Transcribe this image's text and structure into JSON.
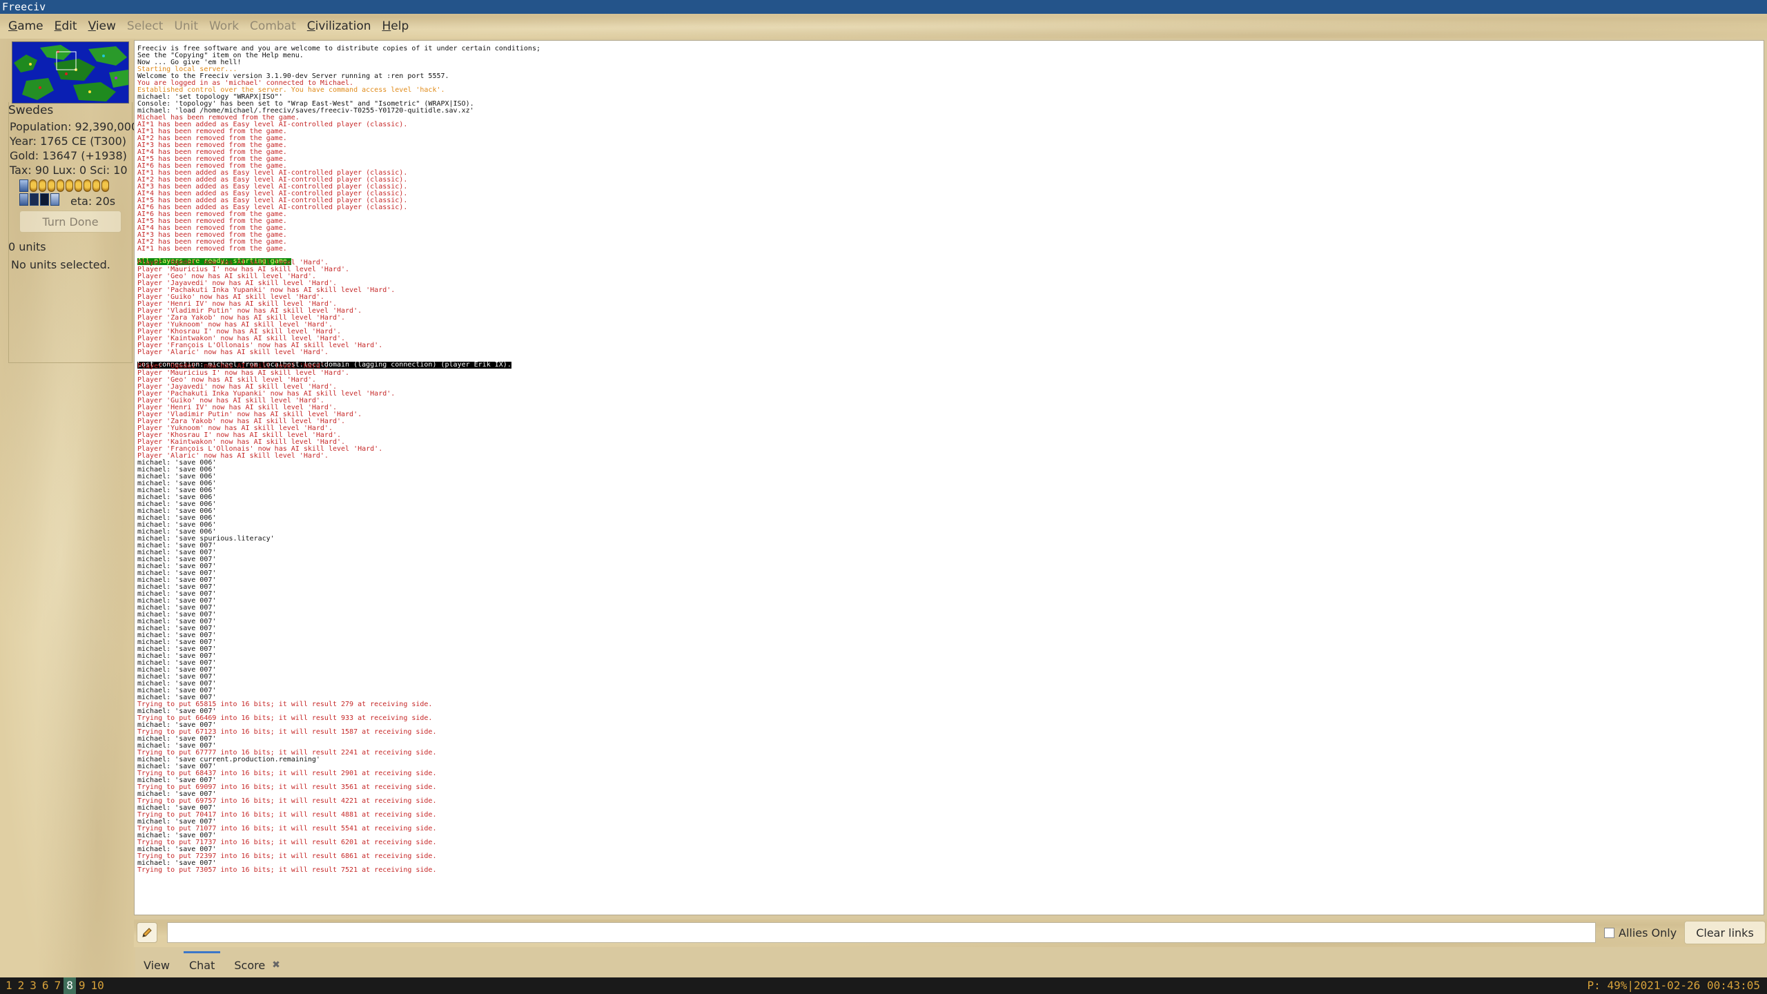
{
  "window": {
    "title": "Freeciv"
  },
  "menu": [
    {
      "label": "Game",
      "u": "G",
      "rest": "ame",
      "enabled": true
    },
    {
      "label": "Edit",
      "u": "E",
      "rest": "dit",
      "enabled": true
    },
    {
      "label": "View",
      "u": "V",
      "rest": "iew",
      "enabled": true
    },
    {
      "label": "Select",
      "u": "",
      "rest": "Select",
      "enabled": false
    },
    {
      "label": "Unit",
      "u": "",
      "rest": "Unit",
      "enabled": false
    },
    {
      "label": "Work",
      "u": "",
      "rest": "Work",
      "enabled": false
    },
    {
      "label": "Combat",
      "u": "",
      "rest": "Combat",
      "enabled": false
    },
    {
      "label": "Civilization",
      "u": "C",
      "rest": "ivilization",
      "enabled": true
    },
    {
      "label": "Help",
      "u": "H",
      "rest": "elp",
      "enabled": true
    }
  ],
  "info": {
    "nation": "Swedes",
    "population": "Population: 92,390,000",
    "year": "Year: 1765 CE (T300)",
    "gold": "Gold: 13647 (+1938)",
    "tax": "Tax: 90 Lux: 0 Sci: 10",
    "eta": "eta: 20s",
    "turn_done": "Turn Done",
    "units_count": "0 units",
    "units_selected": "No units selected."
  },
  "chat": {
    "lines": [
      {
        "c": "blk",
        "t": "Freeciv is free software and you are welcome to distribute copies of it under certain conditions;"
      },
      {
        "c": "blk",
        "t": "See the \"Copying\" item on the Help menu."
      },
      {
        "c": "blk",
        "t": "Now ... Go give 'em hell!"
      },
      {
        "c": "ora",
        "t": "Starting local server..."
      },
      {
        "c": "blk",
        "t": "Welcome to the Freeciv version 3.1.90-dev Server running at :ren port 5557."
      },
      {
        "c": "red",
        "t": "You are logged in as 'michael' connected to Michael."
      },
      {
        "c": "ora",
        "t": "Established control over the server. You have command access level 'hack'."
      },
      {
        "c": "blk",
        "t": "michael: 'set topology \"WRAPX|ISO\"'"
      },
      {
        "c": "blk",
        "t": "Console: 'topology' has been set to \"Wrap East-West\" and \"Isometric\" (WRAPX|ISO)."
      },
      {
        "c": "blk",
        "t": "michael: 'load /home/michael/.freeciv/saves/freeciv-T0255-Y01720-quitidle.sav.xz'"
      },
      {
        "c": "red",
        "t": "Michael has been removed from the game."
      },
      {
        "c": "red",
        "t": "AI*1 has been added as Easy level AI-controlled player (classic)."
      },
      {
        "c": "red",
        "t": "AI*1 has been removed from the game."
      },
      {
        "c": "red",
        "t": "AI*2 has been removed from the game."
      },
      {
        "c": "red",
        "t": "AI*3 has been removed from the game."
      },
      {
        "c": "red",
        "t": "AI*4 has been removed from the game."
      },
      {
        "c": "red",
        "t": "AI*5 has been removed from the game."
      },
      {
        "c": "red",
        "t": "AI*6 has been removed from the game."
      },
      {
        "c": "red",
        "t": "AI*1 has been added as Easy level AI-controlled player (classic)."
      },
      {
        "c": "red",
        "t": "AI*2 has been added as Easy level AI-controlled player (classic)."
      },
      {
        "c": "red",
        "t": "AI*3 has been added as Easy level AI-controlled player (classic)."
      },
      {
        "c": "red",
        "t": "AI*4 has been added as Easy level AI-controlled player (classic)."
      },
      {
        "c": "red",
        "t": "AI*5 has been added as Easy level AI-controlled player (classic)."
      },
      {
        "c": "red",
        "t": "AI*6 has been added as Easy level AI-controlled player (classic)."
      },
      {
        "c": "red",
        "t": "AI*6 has been removed from the game."
      },
      {
        "c": "red",
        "t": "AI*5 has been removed from the game."
      },
      {
        "c": "red",
        "t": "AI*4 has been removed from the game."
      },
      {
        "c": "red",
        "t": "AI*3 has been removed from the game."
      },
      {
        "c": "red",
        "t": "AI*2 has been removed from the game."
      },
      {
        "c": "red",
        "t": "AI*1 has been removed from the game."
      },
      {
        "c": "gh",
        "t": "All players are ready; starting game."
      },
      {
        "c": "red",
        "t": "Player 'Ogedei' now has AI skill level 'Hard'."
      },
      {
        "c": "red",
        "t": "Player 'Mauricius I' now has AI skill level 'Hard'."
      },
      {
        "c": "red",
        "t": "Player 'Geo' now has AI skill level 'Hard'."
      },
      {
        "c": "red",
        "t": "Player 'Jayavedi' now has AI skill level 'Hard'."
      },
      {
        "c": "red",
        "t": "Player 'Pachakuti Inka Yupanki' now has AI skill level 'Hard'."
      },
      {
        "c": "red",
        "t": "Player 'Guiko' now has AI skill level 'Hard'."
      },
      {
        "c": "red",
        "t": "Player 'Henri IV' now has AI skill level 'Hard'."
      },
      {
        "c": "red",
        "t": "Player 'Vladimir Putin' now has AI skill level 'Hard'."
      },
      {
        "c": "red",
        "t": "Player 'Zara Yakob' now has AI skill level 'Hard'."
      },
      {
        "c": "red",
        "t": "Player 'Yuknoom' now has AI skill level 'Hard'."
      },
      {
        "c": "red",
        "t": "Player 'Khosrau I' now has AI skill level 'Hard'."
      },
      {
        "c": "red",
        "t": "Player 'Kaintwakon' now has AI skill level 'Hard'."
      },
      {
        "c": "red",
        "t": "Player 'François L'Ollonais' now has AI skill level 'Hard'."
      },
      {
        "c": "red",
        "t": "Player 'Alaric' now has AI skill level 'Hard'."
      },
      {
        "c": "bh",
        "t": "Lost connection: michael from localhost.localdomain (lagging connection) (player Erik IX)."
      },
      {
        "c": "red",
        "t": "Player 'Ogedei' now has AI skill level 'Hard'."
      },
      {
        "c": "red",
        "t": "Player 'Mauricius I' now has AI skill level 'Hard'."
      },
      {
        "c": "red",
        "t": "Player 'Geo' now has AI skill level 'Hard'."
      },
      {
        "c": "red",
        "t": "Player 'Jayavedi' now has AI skill level 'Hard'."
      },
      {
        "c": "red",
        "t": "Player 'Pachakuti Inka Yupanki' now has AI skill level 'Hard'."
      },
      {
        "c": "red",
        "t": "Player 'Guiko' now has AI skill level 'Hard'."
      },
      {
        "c": "red",
        "t": "Player 'Henri IV' now has AI skill level 'Hard'."
      },
      {
        "c": "red",
        "t": "Player 'Vladimir Putin' now has AI skill level 'Hard'."
      },
      {
        "c": "red",
        "t": "Player 'Zara Yakob' now has AI skill level 'Hard'."
      },
      {
        "c": "red",
        "t": "Player 'Yuknoom' now has AI skill level 'Hard'."
      },
      {
        "c": "red",
        "t": "Player 'Khosrau I' now has AI skill level 'Hard'."
      },
      {
        "c": "red",
        "t": "Player 'Kaintwakon' now has AI skill level 'Hard'."
      },
      {
        "c": "red",
        "t": "Player 'François L'Ollonais' now has AI skill level 'Hard'."
      },
      {
        "c": "red",
        "t": "Player 'Alaric' now has AI skill level 'Hard'."
      },
      {
        "c": "blk",
        "t": "michael: 'save 006'"
      },
      {
        "c": "blk",
        "t": "michael: 'save 006'"
      },
      {
        "c": "blk",
        "t": "michael: 'save 006'"
      },
      {
        "c": "blk",
        "t": "michael: 'save 006'"
      },
      {
        "c": "blk",
        "t": "michael: 'save 006'"
      },
      {
        "c": "blk",
        "t": "michael: 'save 006'"
      },
      {
        "c": "blk",
        "t": "michael: 'save 006'"
      },
      {
        "c": "blk",
        "t": "michael: 'save 006'"
      },
      {
        "c": "blk",
        "t": "michael: 'save 006'"
      },
      {
        "c": "blk",
        "t": "michael: 'save 006'"
      },
      {
        "c": "blk",
        "t": "michael: 'save 006'"
      },
      {
        "c": "blk",
        "t": "michael: 'save spurious.literacy'"
      },
      {
        "c": "blk",
        "t": "michael: 'save 007'"
      },
      {
        "c": "blk",
        "t": "michael: 'save 007'"
      },
      {
        "c": "blk",
        "t": "michael: 'save 007'"
      },
      {
        "c": "blk",
        "t": "michael: 'save 007'"
      },
      {
        "c": "blk",
        "t": "michael: 'save 007'"
      },
      {
        "c": "blk",
        "t": "michael: 'save 007'"
      },
      {
        "c": "blk",
        "t": "michael: 'save 007'"
      },
      {
        "c": "blk",
        "t": "michael: 'save 007'"
      },
      {
        "c": "blk",
        "t": "michael: 'save 007'"
      },
      {
        "c": "blk",
        "t": "michael: 'save 007'"
      },
      {
        "c": "blk",
        "t": "michael: 'save 007'"
      },
      {
        "c": "blk",
        "t": "michael: 'save 007'"
      },
      {
        "c": "blk",
        "t": "michael: 'save 007'"
      },
      {
        "c": "blk",
        "t": "michael: 'save 007'"
      },
      {
        "c": "blk",
        "t": "michael: 'save 007'"
      },
      {
        "c": "blk",
        "t": "michael: 'save 007'"
      },
      {
        "c": "blk",
        "t": "michael: 'save 007'"
      },
      {
        "c": "blk",
        "t": "michael: 'save 007'"
      },
      {
        "c": "blk",
        "t": "michael: 'save 007'"
      },
      {
        "c": "blk",
        "t": "michael: 'save 007'"
      },
      {
        "c": "blk",
        "t": "michael: 'save 007'"
      },
      {
        "c": "blk",
        "t": "michael: 'save 007'"
      },
      {
        "c": "blk",
        "t": "michael: 'save 007'"
      },
      {
        "c": "red",
        "t": "Trying to put 65815 into 16 bits; it will result 279 at receiving side."
      },
      {
        "c": "blk",
        "t": "michael: 'save 007'"
      },
      {
        "c": "red",
        "t": "Trying to put 66469 into 16 bits; it will result 933 at receiving side."
      },
      {
        "c": "blk",
        "t": "michael: 'save 007'"
      },
      {
        "c": "red",
        "t": "Trying to put 67123 into 16 bits; it will result 1587 at receiving side."
      },
      {
        "c": "blk",
        "t": "michael: 'save 007'"
      },
      {
        "c": "blk",
        "t": "michael: 'save 007'"
      },
      {
        "c": "red",
        "t": "Trying to put 67777 into 16 bits; it will result 2241 at receiving side."
      },
      {
        "c": "blk",
        "t": "michael: 'save current.production.remaining'"
      },
      {
        "c": "blk",
        "t": "michael: 'save 007'"
      },
      {
        "c": "red",
        "t": "Trying to put 68437 into 16 bits; it will result 2901 at receiving side."
      },
      {
        "c": "blk",
        "t": "michael: 'save 007'"
      },
      {
        "c": "red",
        "t": "Trying to put 69097 into 16 bits; it will result 3561 at receiving side."
      },
      {
        "c": "blk",
        "t": "michael: 'save 007'"
      },
      {
        "c": "red",
        "t": "Trying to put 69757 into 16 bits; it will result 4221 at receiving side."
      },
      {
        "c": "blk",
        "t": "michael: 'save 007'"
      },
      {
        "c": "red",
        "t": "Trying to put 70417 into 16 bits; it will result 4881 at receiving side."
      },
      {
        "c": "blk",
        "t": "michael: 'save 007'"
      },
      {
        "c": "red",
        "t": "Trying to put 71077 into 16 bits; it will result 5541 at receiving side."
      },
      {
        "c": "blk",
        "t": "michael: 'save 007'"
      },
      {
        "c": "red",
        "t": "Trying to put 71737 into 16 bits; it will result 6201 at receiving side."
      },
      {
        "c": "blk",
        "t": "michael: 'save 007'"
      },
      {
        "c": "red",
        "t": "Trying to put 72397 into 16 bits; it will result 6861 at receiving side."
      },
      {
        "c": "blk",
        "t": "michael: 'save 007'"
      },
      {
        "c": "red",
        "t": "Trying to put 73057 into 16 bits; it will result 7521 at receiving side."
      }
    ]
  },
  "input": {
    "value": "",
    "allies_only": "Allies Only",
    "allies_checked": false,
    "clear_links": "Clear links"
  },
  "tabs": [
    {
      "label": "View",
      "active": false,
      "closable": false
    },
    {
      "label": "Chat",
      "active": true,
      "closable": false
    },
    {
      "label": "Score",
      "active": false,
      "closable": true,
      "close_glyph": "✖"
    }
  ],
  "statusbar": {
    "workspaces": [
      "1",
      "2",
      "3",
      "6",
      "7",
      "8",
      "9",
      "10"
    ],
    "current_workspace": "8",
    "system": "P: 49%|2021-02-26 00:43:05"
  },
  "colors": {
    "titlebar": "#24548a",
    "chat_red": "#c62828",
    "chat_orange": "#e08a18",
    "highlight_green": "#0b8a0b",
    "tab_accent": "#3c76c8",
    "status_text": "#d8a23a"
  }
}
